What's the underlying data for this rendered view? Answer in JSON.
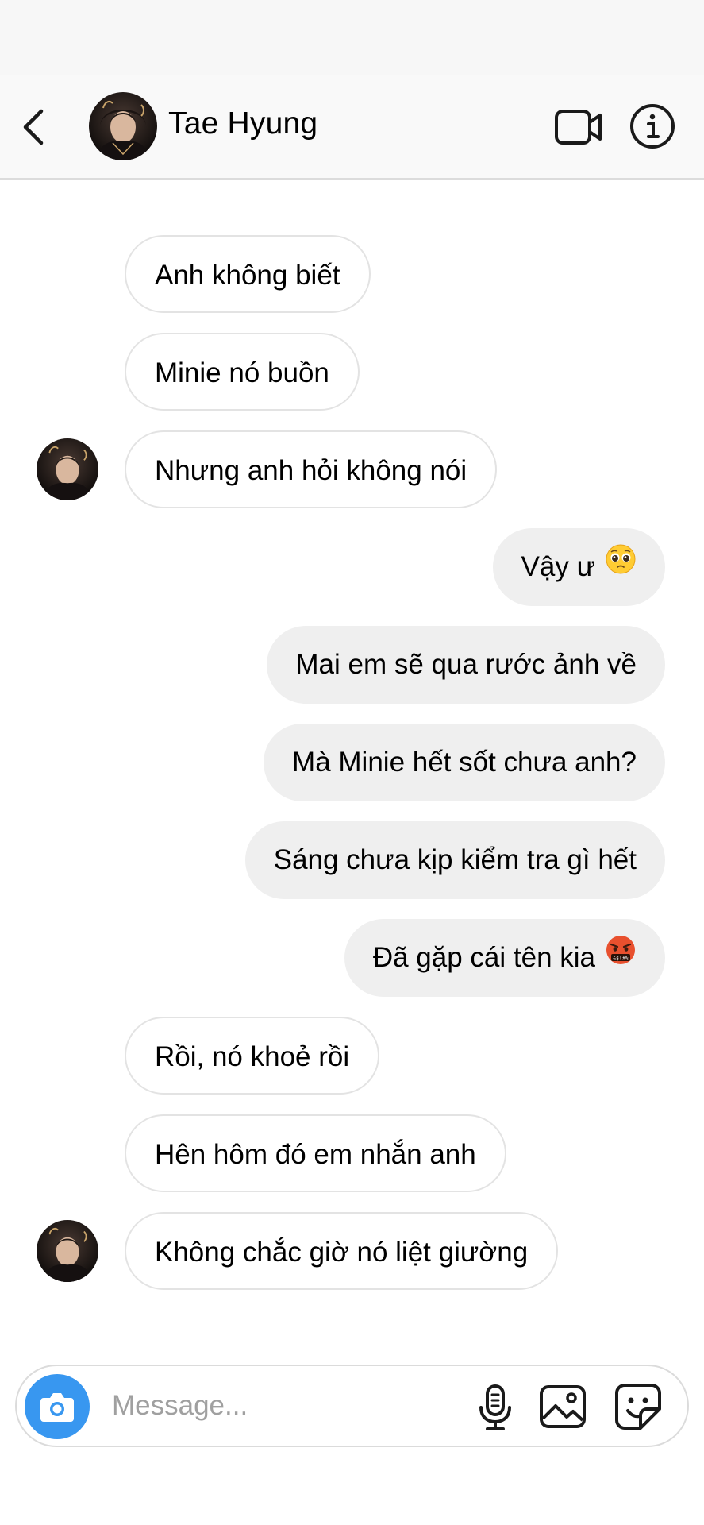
{
  "header": {
    "contact_name": "Tae Hyung"
  },
  "messages": [
    {
      "side": "in",
      "text": "Anh không biết"
    },
    {
      "side": "in",
      "text": "Minie nó buồn"
    },
    {
      "side": "in",
      "text": "Nhưng anh hỏi không nói",
      "avatar": true
    },
    {
      "side": "out",
      "text": "Vậy ư",
      "emoji": "pleading-face"
    },
    {
      "side": "out",
      "text": "Mai em sẽ qua rước ảnh về"
    },
    {
      "side": "out",
      "text": "Mà Minie hết sốt chưa anh?"
    },
    {
      "side": "out",
      "text": "Sáng chưa kịp kiểm tra gì hết"
    },
    {
      "side": "out",
      "text": "Đã gặp cái tên kia",
      "emoji": "face-with-symbols-on-mouth"
    },
    {
      "side": "in",
      "text": "Rồi, nó khoẻ rồi"
    },
    {
      "side": "in",
      "text": "Hên hôm đó em nhắn anh"
    },
    {
      "side": "in",
      "text": "Không chắc giờ nó liệt giường",
      "avatar": true
    }
  ],
  "composer": {
    "placeholder": "Message...",
    "value": ""
  },
  "icons": {
    "back": "chevron-left-icon",
    "video": "video-camera-icon",
    "info": "info-icon",
    "camera": "camera-icon",
    "mic": "microphone-icon",
    "gallery": "image-icon",
    "sticker": "sticker-icon"
  },
  "colors": {
    "header_bg": "#f9f9f9",
    "outgoing_bubble": "#efefef",
    "incoming_border": "#e3e3e3",
    "camera_button": "#3897f0",
    "placeholder": "#a0a0a0"
  }
}
